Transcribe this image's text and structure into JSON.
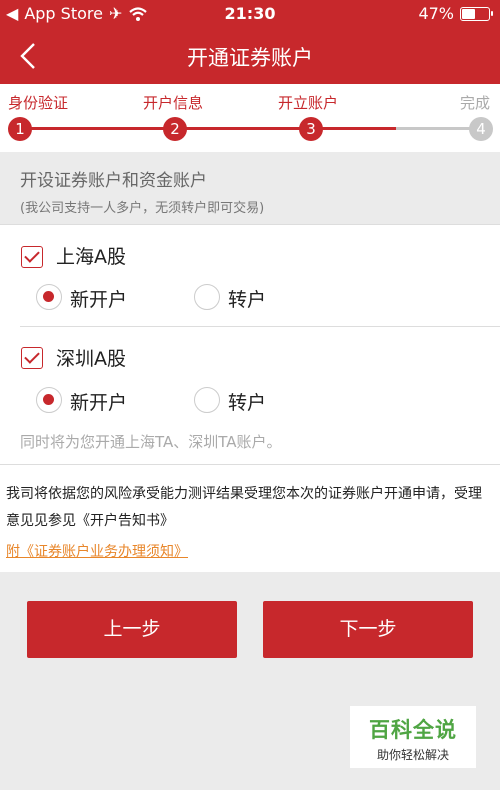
{
  "status_bar": {
    "carrier": "App Store",
    "time": "21:30",
    "battery": "47%",
    "battery_level": 0.47
  },
  "header": {
    "title": "开通证券账户",
    "back_icon": "chevron-left-icon"
  },
  "steps": [
    {
      "label": "身份验证",
      "number": "1",
      "state": "done"
    },
    {
      "label": "开户信息",
      "number": "2",
      "state": "done"
    },
    {
      "label": "开立账户",
      "number": "3",
      "state": "current"
    },
    {
      "label": "完成",
      "number": "4",
      "state": "todo"
    }
  ],
  "intro": {
    "heading": "开设证券账户和资金账户",
    "subheading": "(我公司支持一人多户，无须转户即可交易)"
  },
  "accounts": [
    {
      "label": "上海A股",
      "checked": true,
      "options": [
        {
          "label": "新开户",
          "selected": true
        },
        {
          "label": "转户",
          "selected": false
        }
      ]
    },
    {
      "label": "深圳A股",
      "checked": true,
      "options": [
        {
          "label": "新开户",
          "selected": true
        },
        {
          "label": "转户",
          "selected": false
        }
      ]
    }
  ],
  "note": "同时将为您开通上海TA、深圳TA账户。",
  "disclaimer": {
    "text": "我司将依据您的风险承受能力测评结果受理您本次的证券账户开通申请，受理意见见参见《开户告知书》",
    "link": "附《证券账户业务办理须知》"
  },
  "buttons": {
    "prev": "上一步",
    "next": "下一步"
  },
  "watermark": {
    "title": "百科全说",
    "subtitle": "助你轻松解决"
  },
  "colors": {
    "primary": "#c7282c",
    "link": "#e8862a",
    "inactive": "#c8c8c8",
    "background": "#ebebeb"
  }
}
